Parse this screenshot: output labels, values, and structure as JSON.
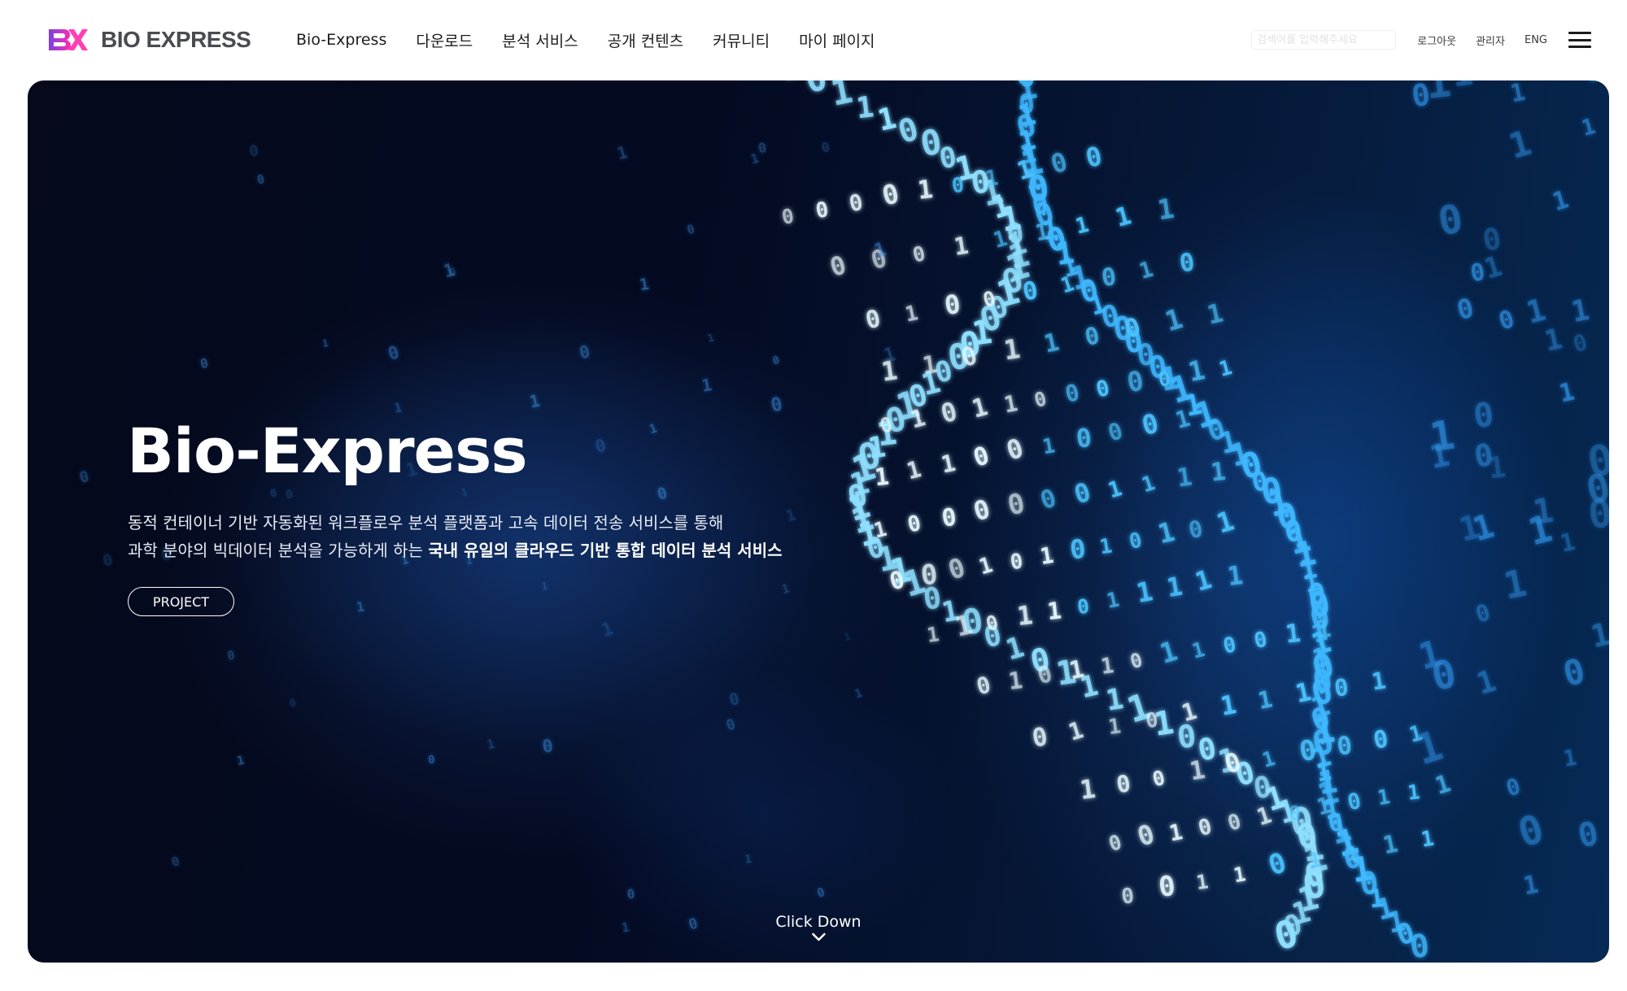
{
  "header": {
    "logo_mark": "BX",
    "logo_text": "BIO EXPRESS",
    "nav": [
      {
        "label": "Bio-Express"
      },
      {
        "label": "다운로드"
      },
      {
        "label": "분석 서비스"
      },
      {
        "label": "공개 컨텐츠"
      },
      {
        "label": "커뮤니티"
      },
      {
        "label": "마이 페이지"
      }
    ],
    "search_placeholder": "검색어를 입력해주세요",
    "logout": "로그아웃",
    "admin": "관리자",
    "lang": "ENG",
    "menu_icon": "hamburger-icon"
  },
  "hero": {
    "title": "Bio-Express",
    "desc_line1": "동적 컨테이너 기반 자동화된 워크플로우 분석 플랫폼과 고속 데이터 전송 서비스를 통해",
    "desc_line2_prefix": "과학 분야의 빅데이터 분석을 가능하게 하는 ",
    "desc_line2_bold": "국내 유일의 클라우드 기반 통합 데이터 분석 서비스",
    "project_button": "PROJECT",
    "click_down": "Click Down",
    "background": "binary-dna-helix-image"
  },
  "colors": {
    "logo_purple": "#7b3fe4",
    "logo_pink": "#ff2fae",
    "hero_dark": "#05091b",
    "digit_blue": "#3fb8ff"
  }
}
